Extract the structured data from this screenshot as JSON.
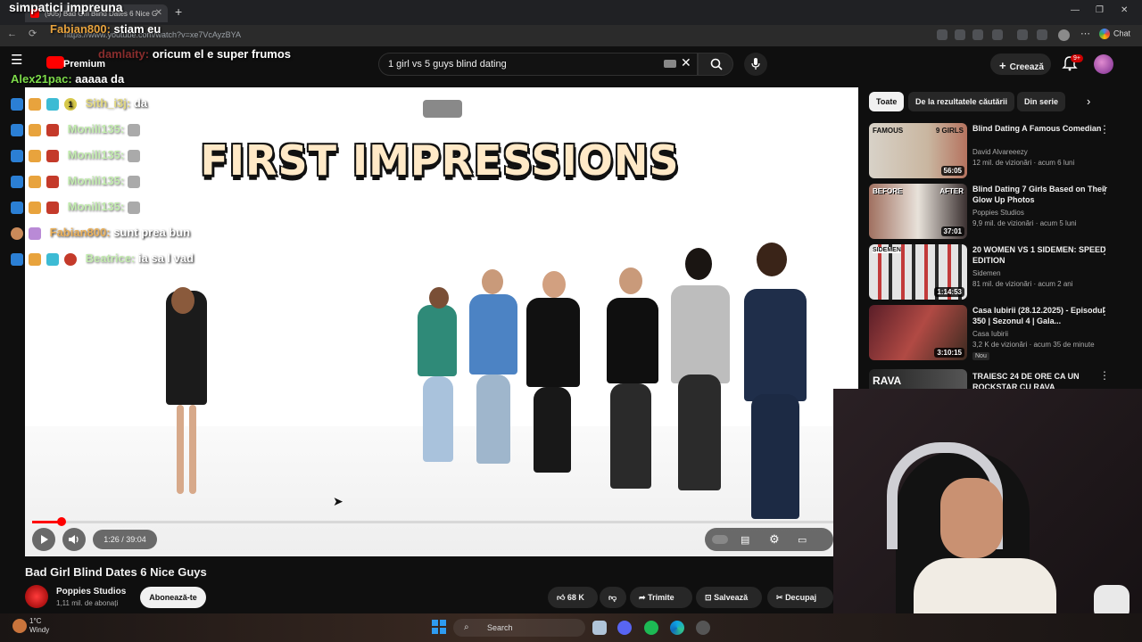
{
  "browser": {
    "tab_title": "(905) Bad Girl Blind Dates 6 Nice G",
    "url": "https://www.youtube.com/watch?v=xe7VcAyzBYA",
    "chat_label": "Chat"
  },
  "overlay": {
    "caption": "simpatici impreuna",
    "top_chat": [
      {
        "user": "Fabian800:",
        "message": "stiam eu",
        "color": "#e8a33d"
      },
      {
        "user": "damlaity:",
        "message": "oricum el e super frumos",
        "color": "#d94040"
      },
      {
        "user": "Alex21pac:",
        "message": "aaaaa da",
        "color": "#7ddc4a"
      }
    ],
    "video_chat": [
      {
        "user": "Sith_i3j:",
        "message": "da",
        "color": "#d6c84a"
      },
      {
        "user": "Monili135:",
        "message": "",
        "color": "#9be07a"
      },
      {
        "user": "Monili135:",
        "message": "",
        "color": "#9be07a"
      },
      {
        "user": "Monili135:",
        "message": "",
        "color": "#9be07a"
      },
      {
        "user": "Monili135:",
        "message": "",
        "color": "#9be07a"
      },
      {
        "user": "Fabian800:",
        "message": "sunt prea bun",
        "color": "#e8a33d"
      },
      {
        "user": "Beatrice:",
        "message": "ia sa l vad",
        "color": "#9be07a"
      }
    ],
    "premium_label": "Premium",
    "badge_number": "1"
  },
  "youtube": {
    "search_query": "1 girl vs 5 guys blind dating",
    "create_label": "Creează",
    "notif_count": "9+"
  },
  "player": {
    "title_overlay": "FIRST IMPRESSIONS",
    "time": "1:26 / 39:04",
    "progress": 0.037
  },
  "video": {
    "title": "Bad Girl Blind Dates 6 Nice Guys",
    "channel": "Poppies Studios",
    "subs": "1,11 mil. de abonați",
    "subscribe": "Abonează-te",
    "likes": "68 K",
    "share": "Trimite",
    "save": "Salvează",
    "clip": "Decupaj"
  },
  "sidebar": {
    "chips": [
      "Toate",
      "De la rezultatele căutării",
      "Din serie"
    ],
    "recs": [
      {
        "title": "Blind Dating A Famous Comedian",
        "channel": "David Alvareeezy",
        "meta": "12 mil. de vizionări · acum 6 luni",
        "duration": "56:05",
        "thumb_text_left": "FAMOUS",
        "thumb_text_right": "9 GIRLS",
        "new": ""
      },
      {
        "title": "Blind Dating 7 Girls Based on Their Glow Up Photos",
        "channel": "Poppies Studios",
        "meta": "9,9 mil. de vizionări · acum 5 luni",
        "duration": "37:01",
        "thumb_text_left": "BEFORE",
        "thumb_text_right": "AFTER",
        "new": ""
      },
      {
        "title": "20 WOMEN VS 1 SIDEMEN: SPEED EDITION",
        "channel": "Sidemen",
        "meta": "81 mil. de vizionări · acum 2 ani",
        "duration": "1:14:53",
        "thumb_text_left": "SIDEMEN",
        "thumb_text_right": "",
        "new": ""
      },
      {
        "title": "Casa Iubirii (28.12.2025) - Episodul 350 | Sezonul 4 | Gala...",
        "channel": "Casa Iubirii",
        "meta": "3,2 K de vizionări · acum 35 de minute",
        "duration": "3:10:15",
        "thumb_text_left": "",
        "thumb_text_right": "",
        "new": "Nou"
      },
      {
        "title": "TRAIESC 24 DE ORE CA UN ROCKSTAR CU RAVA",
        "channel": "",
        "meta": "",
        "duration": "",
        "thumb_text_left": "RAVA",
        "thumb_text_right": "",
        "new": ""
      }
    ]
  },
  "taskbar": {
    "search": "Search",
    "temp": "1°C",
    "weather": "Windy"
  },
  "colors": {
    "accent": "#ff0000",
    "bg": "#0f0f0f"
  }
}
